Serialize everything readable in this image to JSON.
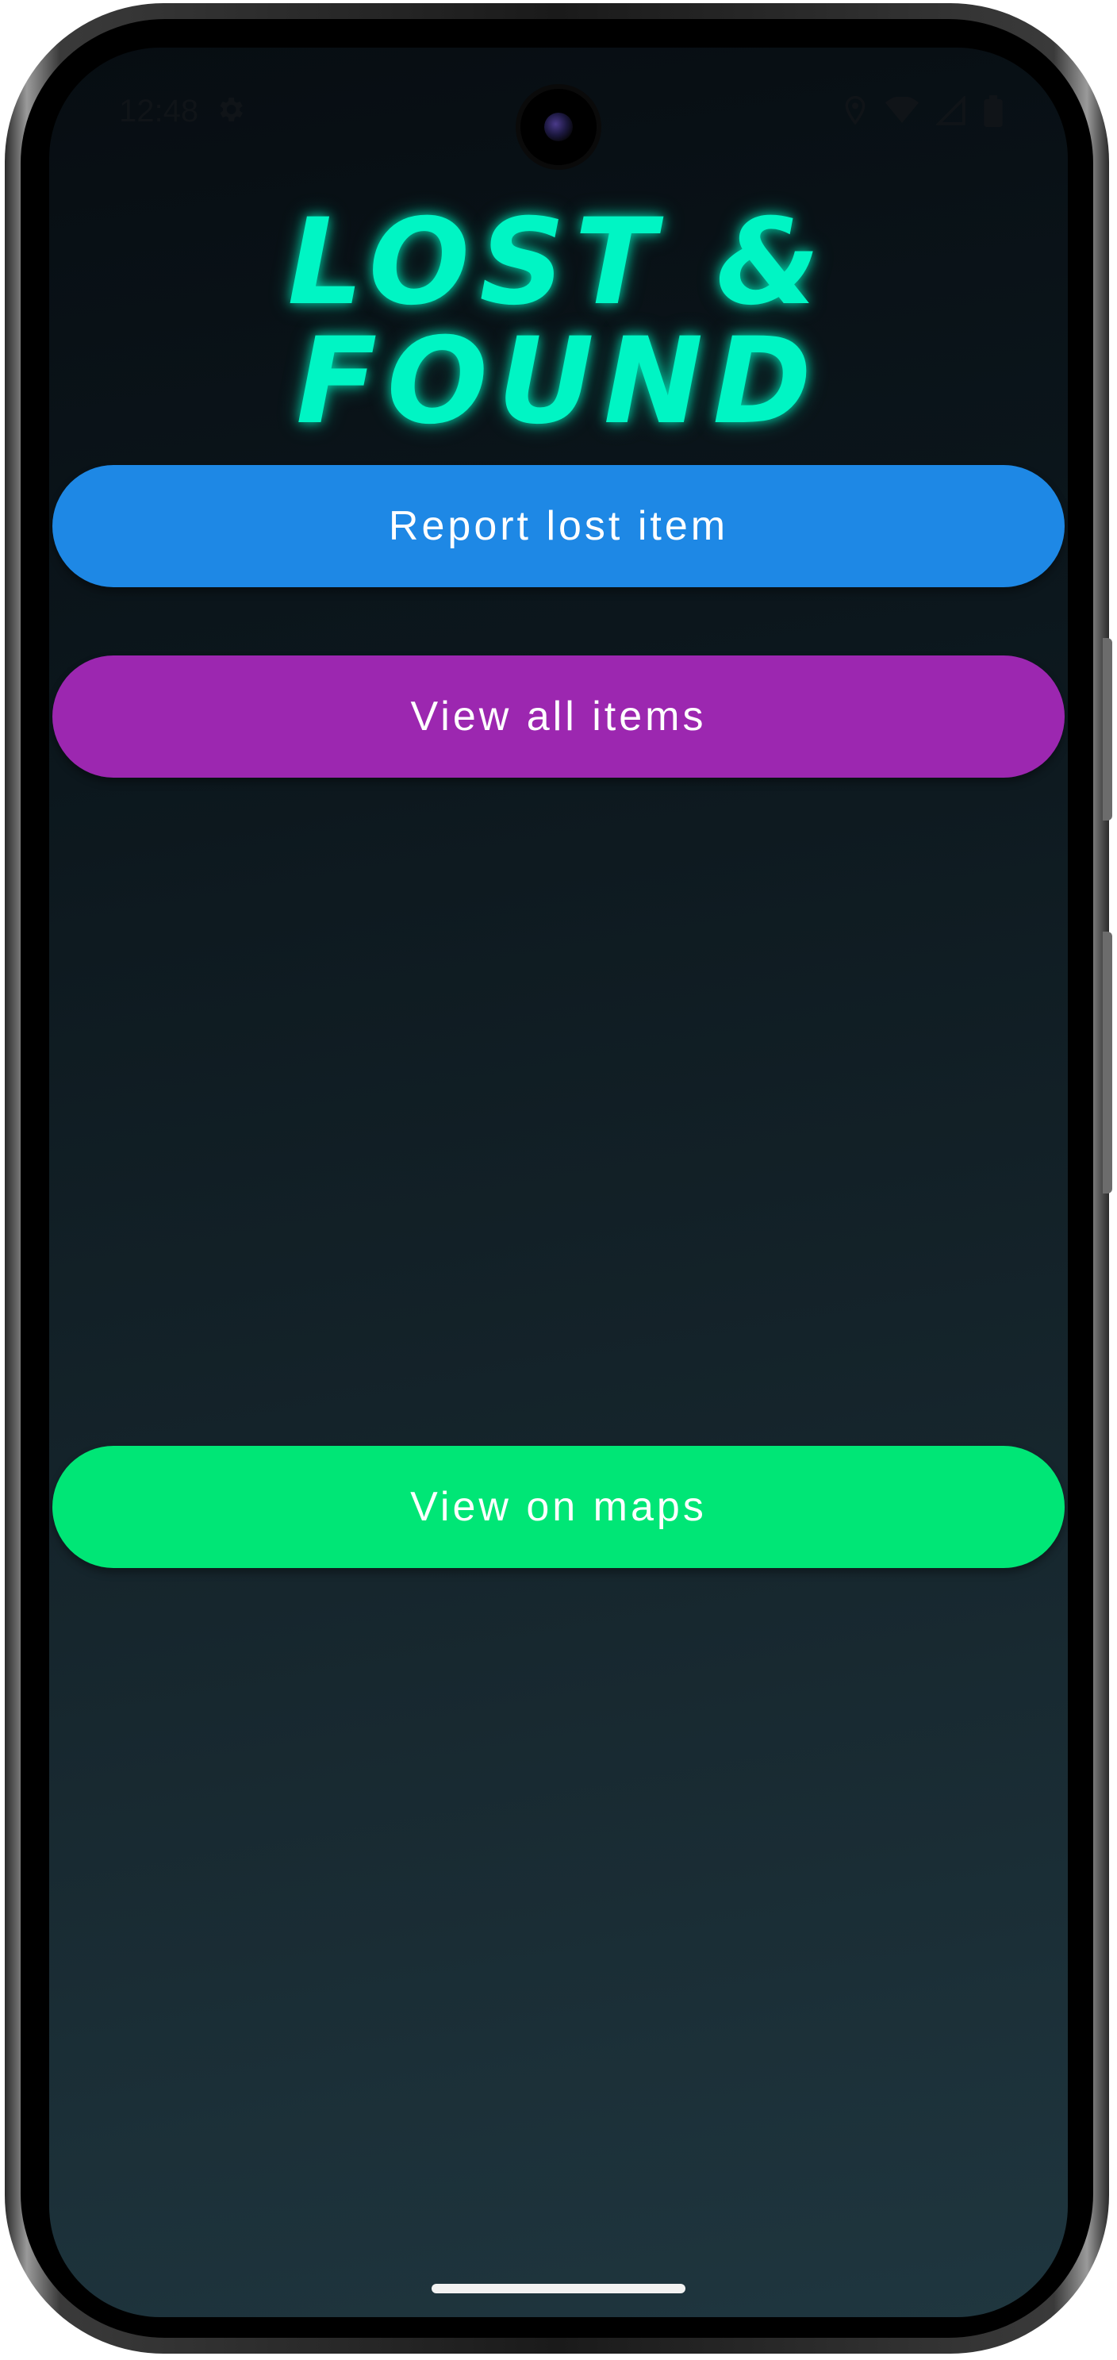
{
  "status_bar": {
    "time": "12:48",
    "icons": [
      "settings-icon",
      "location-icon",
      "wifi-icon",
      "signal-icon",
      "battery-icon"
    ]
  },
  "app": {
    "title": "LOST & FOUND",
    "title_color": "#00f5c4"
  },
  "buttons": {
    "report": {
      "label": "Report lost item",
      "color": "#1e88e5"
    },
    "view_all": {
      "label": "View all items",
      "color": "#9c27b0"
    },
    "maps": {
      "label": "View on maps",
      "color": "#00e676"
    }
  },
  "theme": {
    "background_top": "#070d12",
    "background_bottom": "#1f363f"
  }
}
